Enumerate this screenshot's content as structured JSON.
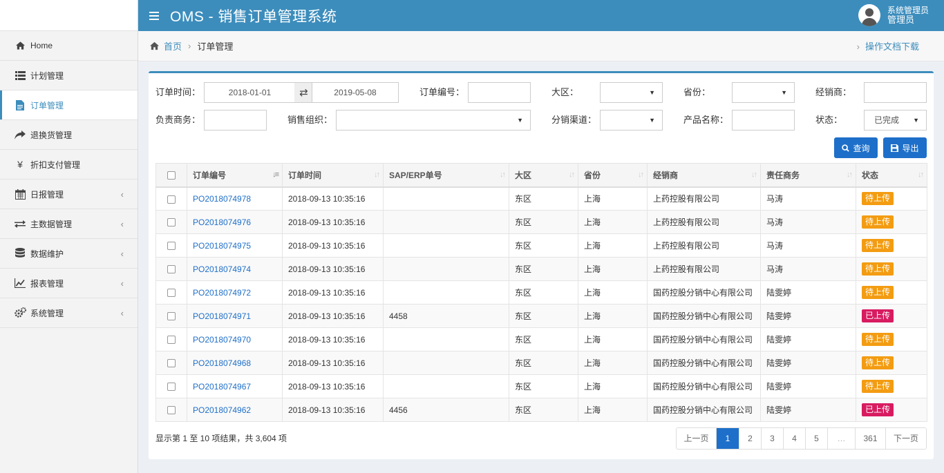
{
  "header": {
    "title": "OMS - 销售订单管理系统",
    "user_name": "系统管理员",
    "user_role": "管理员"
  },
  "sidebar": {
    "items": [
      {
        "label": "Home",
        "icon": "home-icon"
      },
      {
        "label": "计划管理",
        "icon": "list-icon"
      },
      {
        "label": "订单管理",
        "icon": "document-icon"
      },
      {
        "label": "退换货管理",
        "icon": "share-arrow-icon"
      },
      {
        "label": "折扣支付管理",
        "icon": "yen-icon"
      },
      {
        "label": "日报管理",
        "icon": "calendar-icon"
      },
      {
        "label": "主数据管理",
        "icon": "exchange-icon"
      },
      {
        "label": "数据维护",
        "icon": "database-icon"
      },
      {
        "label": "报表管理",
        "icon": "line-chart-icon"
      },
      {
        "label": "系统管理",
        "icon": "gears-icon"
      }
    ]
  },
  "breadcrumb": {
    "home": "首页",
    "current": "订单管理",
    "doc_link": "操作文档下载"
  },
  "filters": {
    "order_time_label": "订单时间：",
    "date_from": "2018-01-01",
    "date_to": "2019-05-08",
    "order_no_label": "订单编号：",
    "order_no_value": "",
    "region_label": "大区：",
    "region_value": "",
    "province_label": "省份：",
    "province_value": "",
    "dealer_label": "经销商：",
    "dealer_value": "",
    "owner_label": "负责商务：",
    "owner_value": "",
    "sales_org_label": "销售组织：",
    "sales_org_value": "",
    "channel_label": "分销渠道：",
    "channel_value": "",
    "product_label": "产品名称：",
    "product_value": "",
    "status_label": "状态：",
    "status_value": "已完成",
    "query_button": "查询",
    "export_button": "导出"
  },
  "table": {
    "columns": [
      "订单编号",
      "订单时间",
      "SAP/ERP单号",
      "大区",
      "省份",
      "经销商",
      "责任商务",
      "状态"
    ],
    "rows": [
      {
        "order_no": "PO2018074978",
        "time": "2018-09-13 10:35:16",
        "sap": "",
        "region": "东区",
        "province": "上海",
        "dealer": "上药控股有限公司",
        "owner": "马涛",
        "status": "待上传"
      },
      {
        "order_no": "PO2018074976",
        "time": "2018-09-13 10:35:16",
        "sap": "",
        "region": "东区",
        "province": "上海",
        "dealer": "上药控股有限公司",
        "owner": "马涛",
        "status": "待上传"
      },
      {
        "order_no": "PO2018074975",
        "time": "2018-09-13 10:35:16",
        "sap": "",
        "region": "东区",
        "province": "上海",
        "dealer": "上药控股有限公司",
        "owner": "马涛",
        "status": "待上传"
      },
      {
        "order_no": "PO2018074974",
        "time": "2018-09-13 10:35:16",
        "sap": "",
        "region": "东区",
        "province": "上海",
        "dealer": "上药控股有限公司",
        "owner": "马涛",
        "status": "待上传"
      },
      {
        "order_no": "PO2018074972",
        "time": "2018-09-13 10:35:16",
        "sap": "",
        "region": "东区",
        "province": "上海",
        "dealer": "国药控股分销中心有限公司",
        "owner": "陆雯婷",
        "status": "待上传"
      },
      {
        "order_no": "PO2018074971",
        "time": "2018-09-13 10:35:16",
        "sap": "4458",
        "region": "东区",
        "province": "上海",
        "dealer": "国药控股分销中心有限公司",
        "owner": "陆雯婷",
        "status": "已上传"
      },
      {
        "order_no": "PO2018074970",
        "time": "2018-09-13 10:35:16",
        "sap": "",
        "region": "东区",
        "province": "上海",
        "dealer": "国药控股分销中心有限公司",
        "owner": "陆雯婷",
        "status": "待上传"
      },
      {
        "order_no": "PO2018074968",
        "time": "2018-09-13 10:35:16",
        "sap": "",
        "region": "东区",
        "province": "上海",
        "dealer": "国药控股分销中心有限公司",
        "owner": "陆雯婷",
        "status": "待上传"
      },
      {
        "order_no": "PO2018074967",
        "time": "2018-09-13 10:35:16",
        "sap": "",
        "region": "东区",
        "province": "上海",
        "dealer": "国药控股分销中心有限公司",
        "owner": "陆雯婷",
        "status": "待上传"
      },
      {
        "order_no": "PO2018074962",
        "time": "2018-09-13 10:35:16",
        "sap": "4456",
        "region": "东区",
        "province": "上海",
        "dealer": "国药控股分销中心有限公司",
        "owner": "陆雯婷",
        "status": "已上传"
      }
    ]
  },
  "status_colors": {
    "待上传": "#f39c12",
    "已上传": "#d81b60"
  },
  "summary": "显示第 1 至 10 项结果，共 3,604 项",
  "pagination": [
    "上一页",
    "1",
    "2",
    "3",
    "4",
    "5",
    "…",
    "361",
    "下一页"
  ],
  "colors": {
    "accent": "#3c8dbc",
    "primary_button": "#1e6fc9"
  }
}
